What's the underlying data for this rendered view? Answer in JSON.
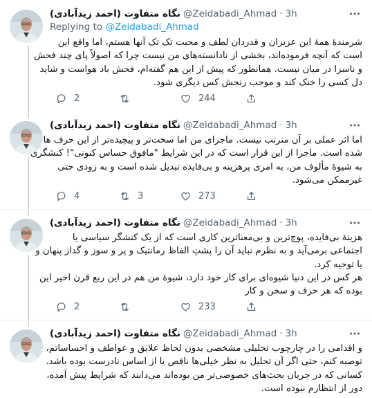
{
  "author": {
    "name": "نگاه متفاوت (احمد زیدآبادی)",
    "handle": "@Zeidabadi_Ahmad"
  },
  "tweets": [
    {
      "time": "3h",
      "replying_label": "Replying to",
      "replying_handle": "@Zeidabadi_Ahmad",
      "lines": [
        "شرمندهٔ همهٔ این عزیزان و قدردان لطف و محبت تک تک آنها هستم، اما واقع این",
        "است که آنچه فرموده‌اند، بخشی از نادانسته‌های من نیست چرا که اصولاً پای چند فحش",
        "و ناسزا در میان نیست. همانطور که پیش از این هم گفته‌ام، فحش باد هواست و شاید",
        "دل کسی را خنک کند و موجب رنجش کس دیگری شود."
      ],
      "replies": "2",
      "retweets": "",
      "likes": "244"
    },
    {
      "time": "3h",
      "lines": [
        "اما اثر عملی بر آن مترتب نیست. ماجرای من اما سخت‌تر و پیچیده‌تر از این حرف ها",
        "شده است. ماجرا از این قرار است که در این شرایط \"مافوق حساس کنونی\"! کنشگری",
        "به شیوهٔ مألوف من، به امری پرهزینه و بی‌فایده تبدیل شده است و به زودی حتی",
        "غیرممکن می‌شود."
      ],
      "replies": "4",
      "retweets": "3",
      "likes": "273"
    },
    {
      "time": "3h",
      "lines": [
        "هزینهٔ بی‌فایده، پوچ‌ترین و بی‌معناترین کاری است که از یک کنشگر سیاسی یا",
        "اجتماعی برمی‌آید و به نظرم نباید آن را پشتِ الفاظ رمانتیک و پر و سوز و گداز پنهان و",
        "یا توجیه کرد.",
        "هر کس در این دنیا شیوه‌ای برای کار خود دارد، شیوهٔ من هم در این ربع قرن اخیر این",
        "بوده که هر حرف و سخن و کار"
      ],
      "replies": "2",
      "retweets": "",
      "likes": "233"
    },
    {
      "time": "3h",
      "lines": [
        "و اقدامی را در چارچوب تحلیلی مشخصی بدون لحاظ علایق و عواطف و احساساتم،",
        "توصیه کنم، حتی اگر آن تحلیل به نظر خیلی‌ها ناقص یا از اساس نادرست بوده باشد.",
        "کسانی که در جریان بحث‌های خصوصی‌تر من بوده‌اند می‌دانند که شرایط پیش آمده،",
        "دور از انتظارم نبوده است."
      ]
    }
  ]
}
